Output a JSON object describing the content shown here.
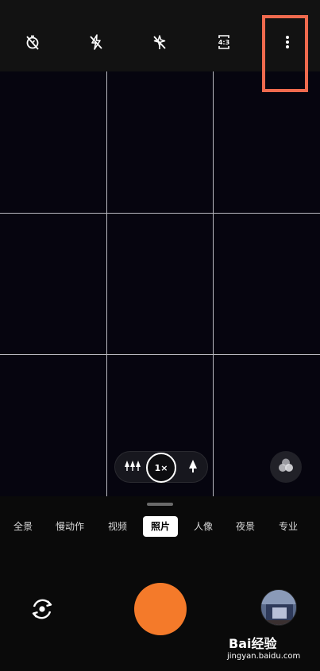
{
  "topbar": {
    "timer_icon": "timer-off-icon",
    "flash_icon": "flash-off-icon",
    "ai_icon": "ai-scene-off-icon",
    "aspect_ratio": "4:3",
    "more_icon": "more-vertical-icon"
  },
  "zoom": {
    "wide_icon": "trees-wide-icon",
    "current": "1×",
    "tele_icon": "tree-tele-icon"
  },
  "modes": [
    "全景",
    "慢动作",
    "视频",
    "照片",
    "人像",
    "夜景",
    "专业"
  ],
  "active_mode": "照片",
  "colors": {
    "shutter": "#f47a2a",
    "highlight": "#ef6a4e",
    "viewfinder": "#06050f"
  },
  "watermark": {
    "logo": "Bai经验",
    "url": "jingyan.baidu.com"
  }
}
